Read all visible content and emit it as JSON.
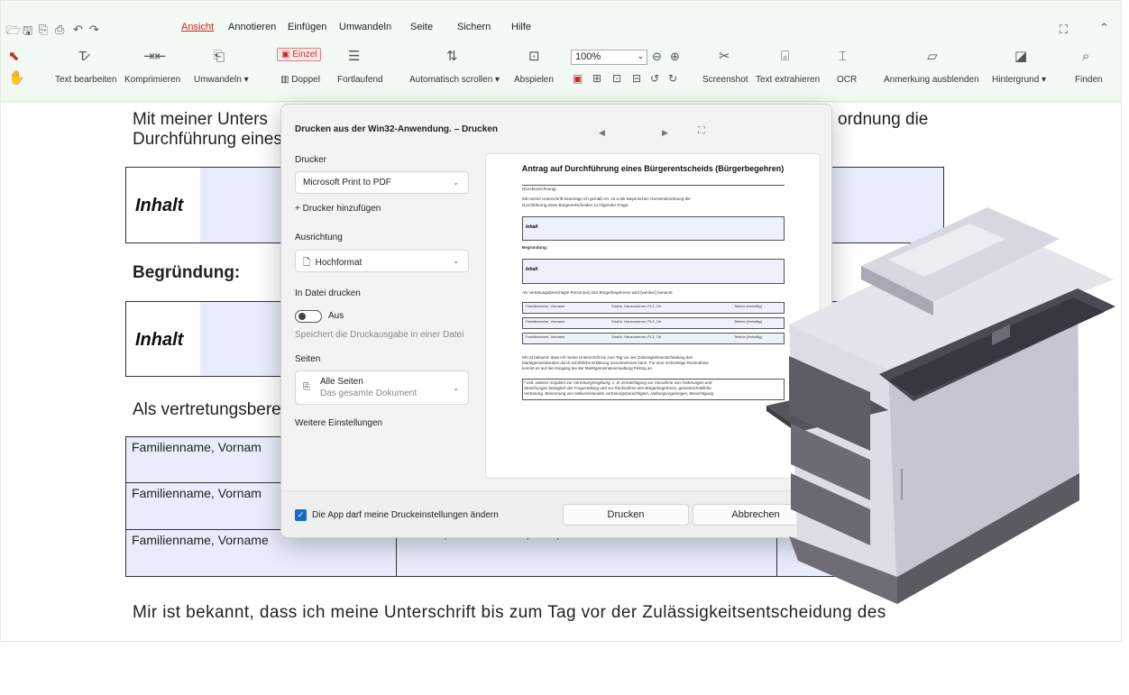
{
  "quick_access": [
    "open-icon",
    "save-icon",
    "save-as-icon",
    "print-icon",
    "undo-icon",
    "redo-icon"
  ],
  "menu": [
    {
      "label": "Ansicht",
      "active": true
    },
    {
      "label": "Annotieren"
    },
    {
      "label": "Einfügen"
    },
    {
      "label": "Umwandeln"
    },
    {
      "label": "Seite"
    },
    {
      "label": "Sichern"
    },
    {
      "label": "Hilfe"
    }
  ],
  "toolbar": {
    "text_bearbeiten": "Text bearbeiten",
    "komprimieren": "Komprimieren",
    "umwandeln": "Umwandeln ▾",
    "einzel": "Einzel",
    "doppel": "Doppel",
    "fortlaufend": "Fortlaufend",
    "auto_scroll": "Automatisch scrollen ▾",
    "abspielen": "Abspielen",
    "zoom": "100%",
    "screenshot": "Screenshot",
    "text_extrahieren": "Text extrahieren",
    "ocr": "OCR",
    "anmerkung": "Anmerkung ausblenden",
    "hintergrund": "Hintergrund ▾",
    "finden": "Finden"
  },
  "doc": {
    "line1_a": "Mit meiner Unters",
    "line1_b": "ordnung die",
    "line2": "Durchführung eines",
    "inhalt": "Inhalt",
    "begruendung": "Begründung:",
    "vertretung": "Als vertretungsbere",
    "row_name": "Familienname, Vorname",
    "row_name_short": "Familienname, Vornam",
    "row_street": "Straße, Hausnummer, PLZ, Ort",
    "bottom": "Mir ist bekannt, dass ich meine Unterschrift bis zum Tag vor der Zulässigkeitsentscheidung des"
  },
  "dialog": {
    "title": "Drucken aus der Win32-Anwendung. – Drucken",
    "drucker_label": "Drucker",
    "drucker_value": "Microsoft Print to PDF",
    "add_printer": "+  Drucker hinzufügen",
    "ausrichtung_label": "Ausrichtung",
    "ausrichtung_value": "Hochformat",
    "datei_label": "In Datei drucken",
    "datei_toggle": "Aus",
    "datei_hint": "Speichert die Druckausgabe in einer Datei",
    "seiten_label": "Seiten",
    "seiten_value": "Alle Seiten",
    "seiten_sub": "Das gesamte Dokument",
    "weitere": "Weitere Einstellungen",
    "checkbox": "Die App darf meine Druckeinstellungen ändern",
    "drucken": "Drucken",
    "abbrechen": "Abbrechen"
  },
  "preview": {
    "title": "Antrag auf Durchführung eines Bürgerentscheids (Bürgerbegehren)",
    "kurz": "(Kurzbezeichnung)",
    "intro1": "Mit meiner Unterschrift beantrage ich gemäß Art. 18 a der Bayerischen Gemeindeordnung die",
    "intro2": "Durchführung eines Bürgerentscheides zu folgender Frage:",
    "inhalt": "Inhalt",
    "begruendung": "Begründung:",
    "vertretung": "Als vertretungsberechtigte Person(en) des Bürgerbegehrens wird (werden) benannt:",
    "col1": "Familienname, Vorname",
    "col2": "Straße, Hausnummer, PLZ, Ort",
    "col3": "Telefon (freiwillig)",
    "p1": "Mir ist bekannt, dass ich meine Unterschrift bis zum Tag vor der Zulässigkeitsentscheidung des",
    "p2": "Marktgemeinderates durch schriftliche Erklärung zurücknehmen kann. Für eine rechtzeitige Rücknahme",
    "p3": "kommt es auf den Eingang bei der Marktgemeindeverwaltung Peiting an.",
    "n1": "* evtl. weitere Angaben zur Vertretungsregelung, z. B. Ermächtigung zur Vornahme von Änderungen und",
    "n2": "Streichungen bezüglich der Fragestellung und zur Rücknahme des Bürgerbegehrens, gemeinschaftliche",
    "n3": "Vertretung, Benennung von stellvertretenden vertretungsberechtigten, Haftungsregelungen, Berechtigung"
  }
}
